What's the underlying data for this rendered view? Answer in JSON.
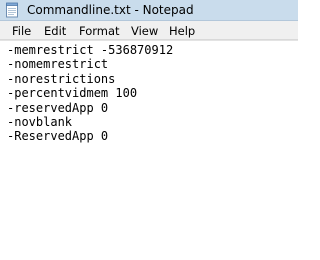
{
  "window": {
    "title": "Commandline.txt - Notepad",
    "icon": "notepad-icon"
  },
  "menu": {
    "items": [
      "File",
      "Edit",
      "Format",
      "View",
      "Help"
    ]
  },
  "document": {
    "lines": [
      "-memrestrict -536870912",
      "-nomemrestrict",
      "-norestrictions",
      "-percentvidmem 100",
      "-reservedApp 0",
      "-novblank",
      "-ReservedApp 0"
    ]
  },
  "colors": {
    "titlebar": "#c9dcec",
    "menubar": "#f0f0f0",
    "editor_bg": "#ffffff",
    "text": "#000000"
  }
}
